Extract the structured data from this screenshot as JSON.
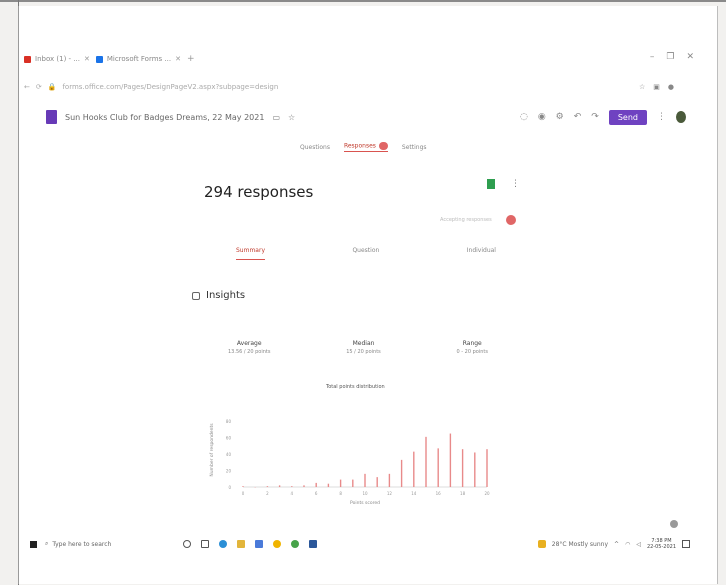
{
  "browser": {
    "tabs": [
      {
        "label": "Inbox (1) - ...",
        "color": "#d93025"
      },
      {
        "label": "Microsoft Forms ...",
        "color": "#1a73e8"
      }
    ],
    "new_tab": "+",
    "address": "forms.office.com/Pages/DesignPageV2.aspx?subpage=design",
    "window_controls": [
      "–",
      "❐",
      "✕"
    ]
  },
  "form_header": {
    "title": "Sun Hooks Club for Badges Dreams, 22 May 2021",
    "send_label": "Send",
    "colors": {
      "accent": "#6f42c1"
    }
  },
  "main_tabs": [
    "Questions",
    "Responses",
    "Settings"
  ],
  "responses_count": "294 responses",
  "accepting_label": "Accepting responses",
  "sub_tabs": [
    "Summary",
    "Question",
    "Individual"
  ],
  "insights": {
    "title": "Insights",
    "stats": [
      {
        "label": "Average",
        "value": "13.56 / 20 points"
      },
      {
        "label": "Median",
        "value": "15 / 20 points"
      },
      {
        "label": "Range",
        "value": "0 - 20 points"
      }
    ]
  },
  "chart_data": {
    "type": "bar",
    "title": "Total points distribution",
    "xlabel": "Points scored",
    "ylabel": "Number of respondents",
    "categories": [
      "0",
      "1",
      "2",
      "3",
      "4",
      "5",
      "6",
      "7",
      "8",
      "9",
      "10",
      "11",
      "12",
      "13",
      "14",
      "15",
      "16",
      "17",
      "18",
      "19",
      "20"
    ],
    "values": [
      1,
      0,
      1,
      2,
      1,
      2,
      5,
      4,
      9,
      9,
      16,
      12,
      16,
      33,
      43,
      61,
      47,
      65,
      46,
      42,
      46
    ],
    "x_ticks": [
      "0",
      "2",
      "4",
      "6",
      "8",
      "10",
      "12",
      "14",
      "16",
      "18",
      "20"
    ],
    "y_ticks": [
      "0",
      "20",
      "40",
      "60",
      "80"
    ],
    "ylim": [
      0,
      90
    ],
    "bar_color": "#e88a8a"
  },
  "taskbar": {
    "search_placeholder": "Type here to search",
    "weather": "28°C Mostly sunny",
    "time": "7:38 PM",
    "date": "22-05-2021"
  }
}
